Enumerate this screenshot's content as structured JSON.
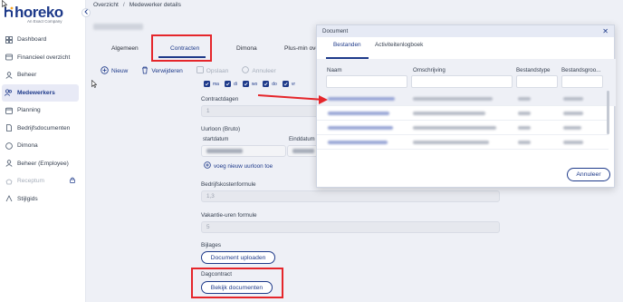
{
  "brand": {
    "name": "horeko",
    "tagline": "An Exact Company",
    "accent": "#1e3a8a",
    "highlight": "#e5262b"
  },
  "sidebar": {
    "items": [
      {
        "label": "Dashboard",
        "icon": "dashboard-icon"
      },
      {
        "label": "Financieel overzicht",
        "icon": "finance-icon"
      },
      {
        "label": "Beheer",
        "icon": "user-icon"
      },
      {
        "label": "Medewerkers",
        "icon": "users-icon"
      },
      {
        "label": "Planning",
        "icon": "calendar-icon"
      },
      {
        "label": "Bedrijfsdocumenten",
        "icon": "document-icon"
      },
      {
        "label": "Dimona",
        "icon": "dimona-icon"
      },
      {
        "label": "Beheer (Employee)",
        "icon": "user-icon"
      },
      {
        "label": "Receptum",
        "icon": "receptum-icon"
      },
      {
        "label": "Stijlgids",
        "icon": "styleguide-icon"
      }
    ]
  },
  "breadcrumb": {
    "root": "Overzicht",
    "separator": "/",
    "current": "Medewerker details"
  },
  "tabs": [
    "Algemeen",
    "Contracten",
    "Dimona",
    "Plus-min ove"
  ],
  "toolbar": {
    "new": "Nieuw",
    "delete": "Verwijderen",
    "save": "Opslaan",
    "cancel": "Annuleer"
  },
  "days": [
    "ma",
    "di",
    "wo",
    "do",
    "vr"
  ],
  "form": {
    "contract_days_label": "Contractdagen",
    "contract_days_value": "1",
    "hourly_wage_label": "Uurloon (Bruto)",
    "start_date_label": "startdatum",
    "end_date_label": "Einddatum",
    "add_wage_link": "voeg nieuw uurloon toe",
    "company_cost_label": "Bedrijfskostenformule",
    "company_cost_value": "1,3",
    "holiday_hours_label": "Vakantie-uren formule",
    "holiday_hours_value": "5",
    "attachments_label": "Bijlages",
    "upload_button": "Document uploaden",
    "day_contract_label": "Dagcontract",
    "view_button": "Bekijk documenten"
  },
  "modal": {
    "title": "Document",
    "tabs": [
      "Bestanden",
      "Activiteitenlogboek"
    ],
    "columns": [
      "Naam",
      "Omschrijving",
      "Bestandstype",
      "Bestandsgroo..."
    ],
    "cancel": "Annuleer"
  }
}
